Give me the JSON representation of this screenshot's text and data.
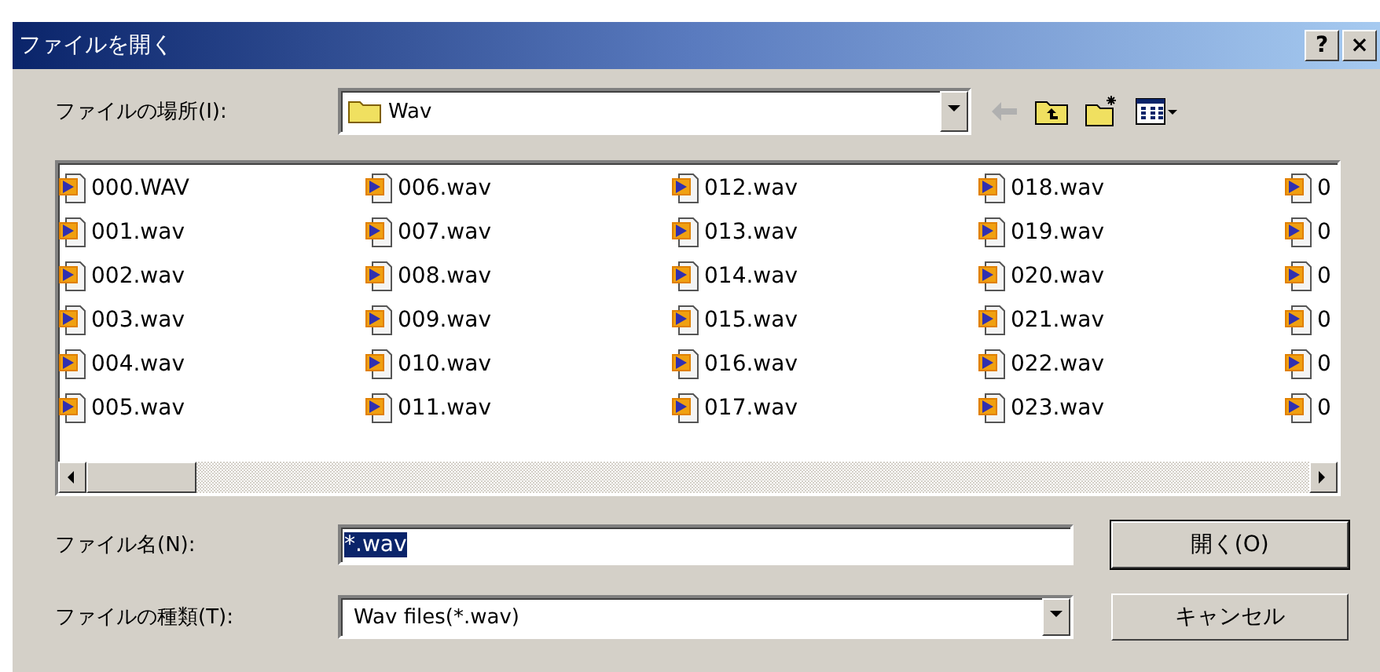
{
  "window": {
    "title": "ファイルを開く",
    "title_buttons": [
      "?",
      "×"
    ]
  },
  "location": {
    "label": "ファイルの場所(I):",
    "value": "Wav"
  },
  "toolbar": [
    {
      "kind": "back",
      "disabled": true
    },
    {
      "kind": "up",
      "disabled": false
    },
    {
      "kind": "newfolder",
      "disabled": false
    },
    {
      "kind": "views",
      "disabled": false
    }
  ],
  "files": [
    {
      "name": "000.WAV"
    },
    {
      "name": "001.wav"
    },
    {
      "name": "002.wav"
    },
    {
      "name": "003.wav"
    },
    {
      "name": "004.wav"
    },
    {
      "name": "005.wav"
    },
    {
      "name": "006.wav"
    },
    {
      "name": "007.wav"
    },
    {
      "name": "008.wav"
    },
    {
      "name": "009.wav"
    },
    {
      "name": "010.wav"
    },
    {
      "name": "011.wav"
    },
    {
      "name": "012.wav"
    },
    {
      "name": "013.wav"
    },
    {
      "name": "014.wav"
    },
    {
      "name": "015.wav"
    },
    {
      "name": "016.wav"
    },
    {
      "name": "017.wav"
    },
    {
      "name": "018.wav"
    },
    {
      "name": "019.wav"
    },
    {
      "name": "020.wav"
    },
    {
      "name": "021.wav"
    },
    {
      "name": "022.wav"
    },
    {
      "name": "023.wav"
    },
    {
      "name": "0"
    },
    {
      "name": "0"
    },
    {
      "name": "0"
    },
    {
      "name": "0"
    },
    {
      "name": "0"
    },
    {
      "name": "0"
    }
  ],
  "filename": {
    "label": "ファイル名(N):",
    "value": "*.wav",
    "selected": true
  },
  "filetype": {
    "label": "ファイルの種類(T):",
    "value": "Wav files(*.wav)"
  },
  "buttons": [
    {
      "label": "開く(O)",
      "default": true
    },
    {
      "label": "キャンセル",
      "default": false
    }
  ]
}
